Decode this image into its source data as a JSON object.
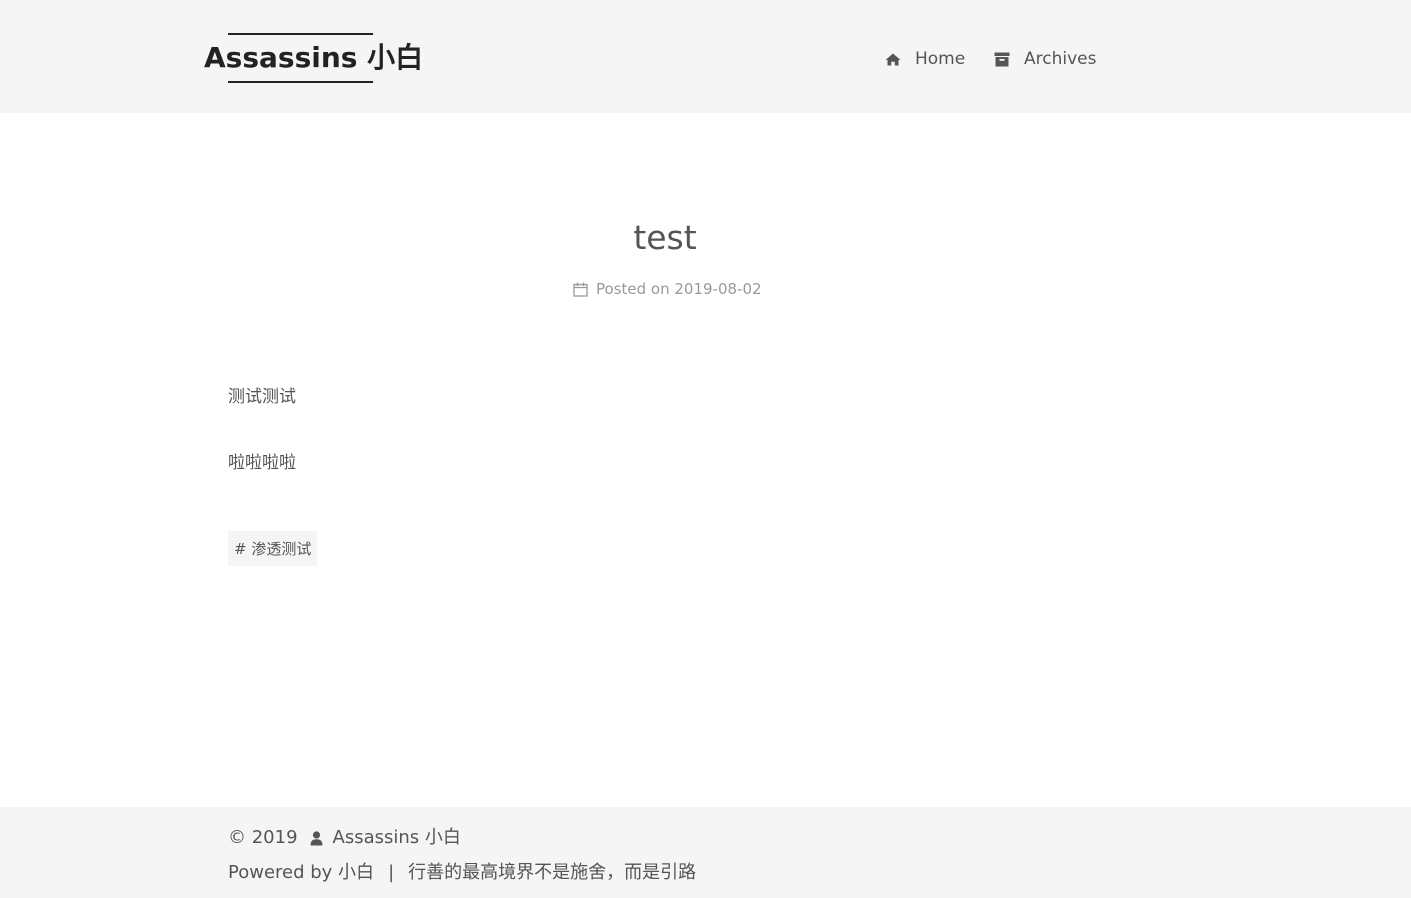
{
  "header": {
    "brand_title": "Assassins 小白",
    "nav": [
      {
        "label": "Home",
        "icon": "home-icon"
      },
      {
        "label": "Archives",
        "icon": "archive-icon"
      }
    ]
  },
  "post": {
    "title": "test",
    "meta_label": "Posted on",
    "date": "2019-08-02",
    "paragraphs": [
      "测试测试",
      "啦啦啦啦"
    ],
    "tags": [
      "# 渗透测试"
    ]
  },
  "footer": {
    "copyright": "© 2019",
    "author": "Assassins 小白",
    "powered_by": "Powered by 小白",
    "separator": "|",
    "motto": "行善的最高境界不是施舍，而是引路"
  },
  "colors": {
    "header_bg": "#f5f5f5",
    "text": "#555555",
    "meta_text": "#999999",
    "brand_text": "#222222"
  }
}
